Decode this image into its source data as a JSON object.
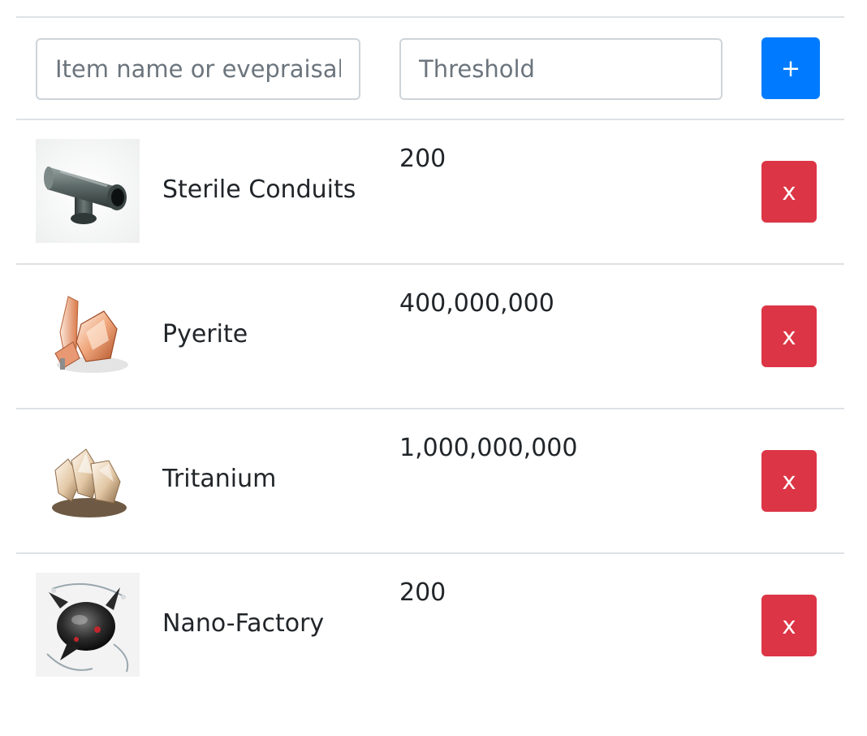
{
  "form": {
    "name_placeholder": "Item name or evepraisal",
    "threshold_placeholder": "Threshold",
    "add_label": "+"
  },
  "items": [
    {
      "name": "Sterile Conduits",
      "threshold": "200",
      "remove_label": "x",
      "icon": "sterile-conduits-icon"
    },
    {
      "name": "Pyerite",
      "threshold": "400,000,000",
      "remove_label": "x",
      "icon": "pyerite-icon"
    },
    {
      "name": "Tritanium",
      "threshold": "1,000,000,000",
      "remove_label": "x",
      "icon": "tritanium-icon"
    },
    {
      "name": "Nano-Factory",
      "threshold": "200",
      "remove_label": "x",
      "icon": "nano-factory-icon"
    }
  ],
  "colors": {
    "add_button": "#007bff",
    "remove_button": "#dc3545",
    "divider": "#dee2e6"
  }
}
